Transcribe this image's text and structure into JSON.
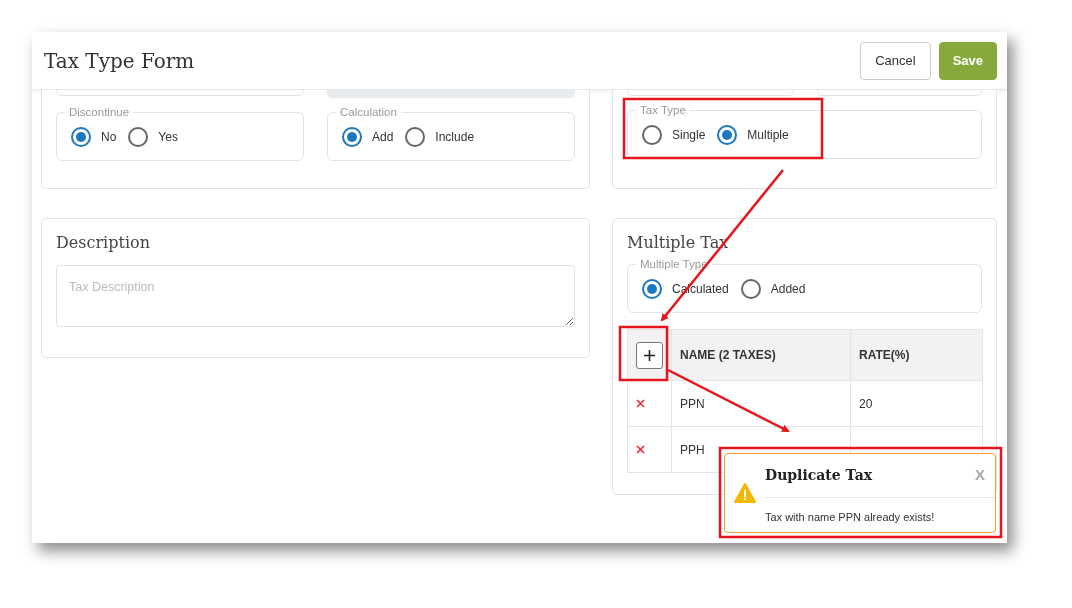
{
  "window": {
    "title": "Tax Type Form"
  },
  "buttons": [
    {
      "label": "Cancel",
      "kind": "secondary"
    },
    {
      "label": "Save",
      "kind": "primary"
    }
  ],
  "general": {
    "groups": [
      {
        "legend": "Discontinue",
        "options": [
          {
            "label": "No",
            "selected": true
          },
          {
            "label": "Yes",
            "selected": false
          }
        ]
      },
      {
        "legend": "Calculation",
        "options": [
          {
            "label": "Add",
            "selected": true
          },
          {
            "label": "Include",
            "selected": false
          }
        ]
      }
    ]
  },
  "tax_type": {
    "legend": "Tax Type",
    "options": [
      {
        "label": "Single",
        "selected": false
      },
      {
        "label": "Multiple",
        "selected": true
      }
    ]
  },
  "description": {
    "title": "Description",
    "placeholder": "Tax Description"
  },
  "multiple_tax": {
    "title": "Multiple Tax",
    "type_group": {
      "legend": "Multiple Type",
      "options": [
        {
          "label": "Calculated",
          "selected": true
        },
        {
          "label": "Added",
          "selected": false
        }
      ]
    },
    "table": {
      "columns": [
        "NAME (2 TAXES)",
        "RATE(%)"
      ],
      "rows": [
        {
          "name": "PPN",
          "rate": "20"
        },
        {
          "name": "PPH"
        }
      ]
    }
  },
  "toast": {
    "title": "Duplicate Tax",
    "close": "X",
    "message": "Tax with name PPN already exists!"
  }
}
